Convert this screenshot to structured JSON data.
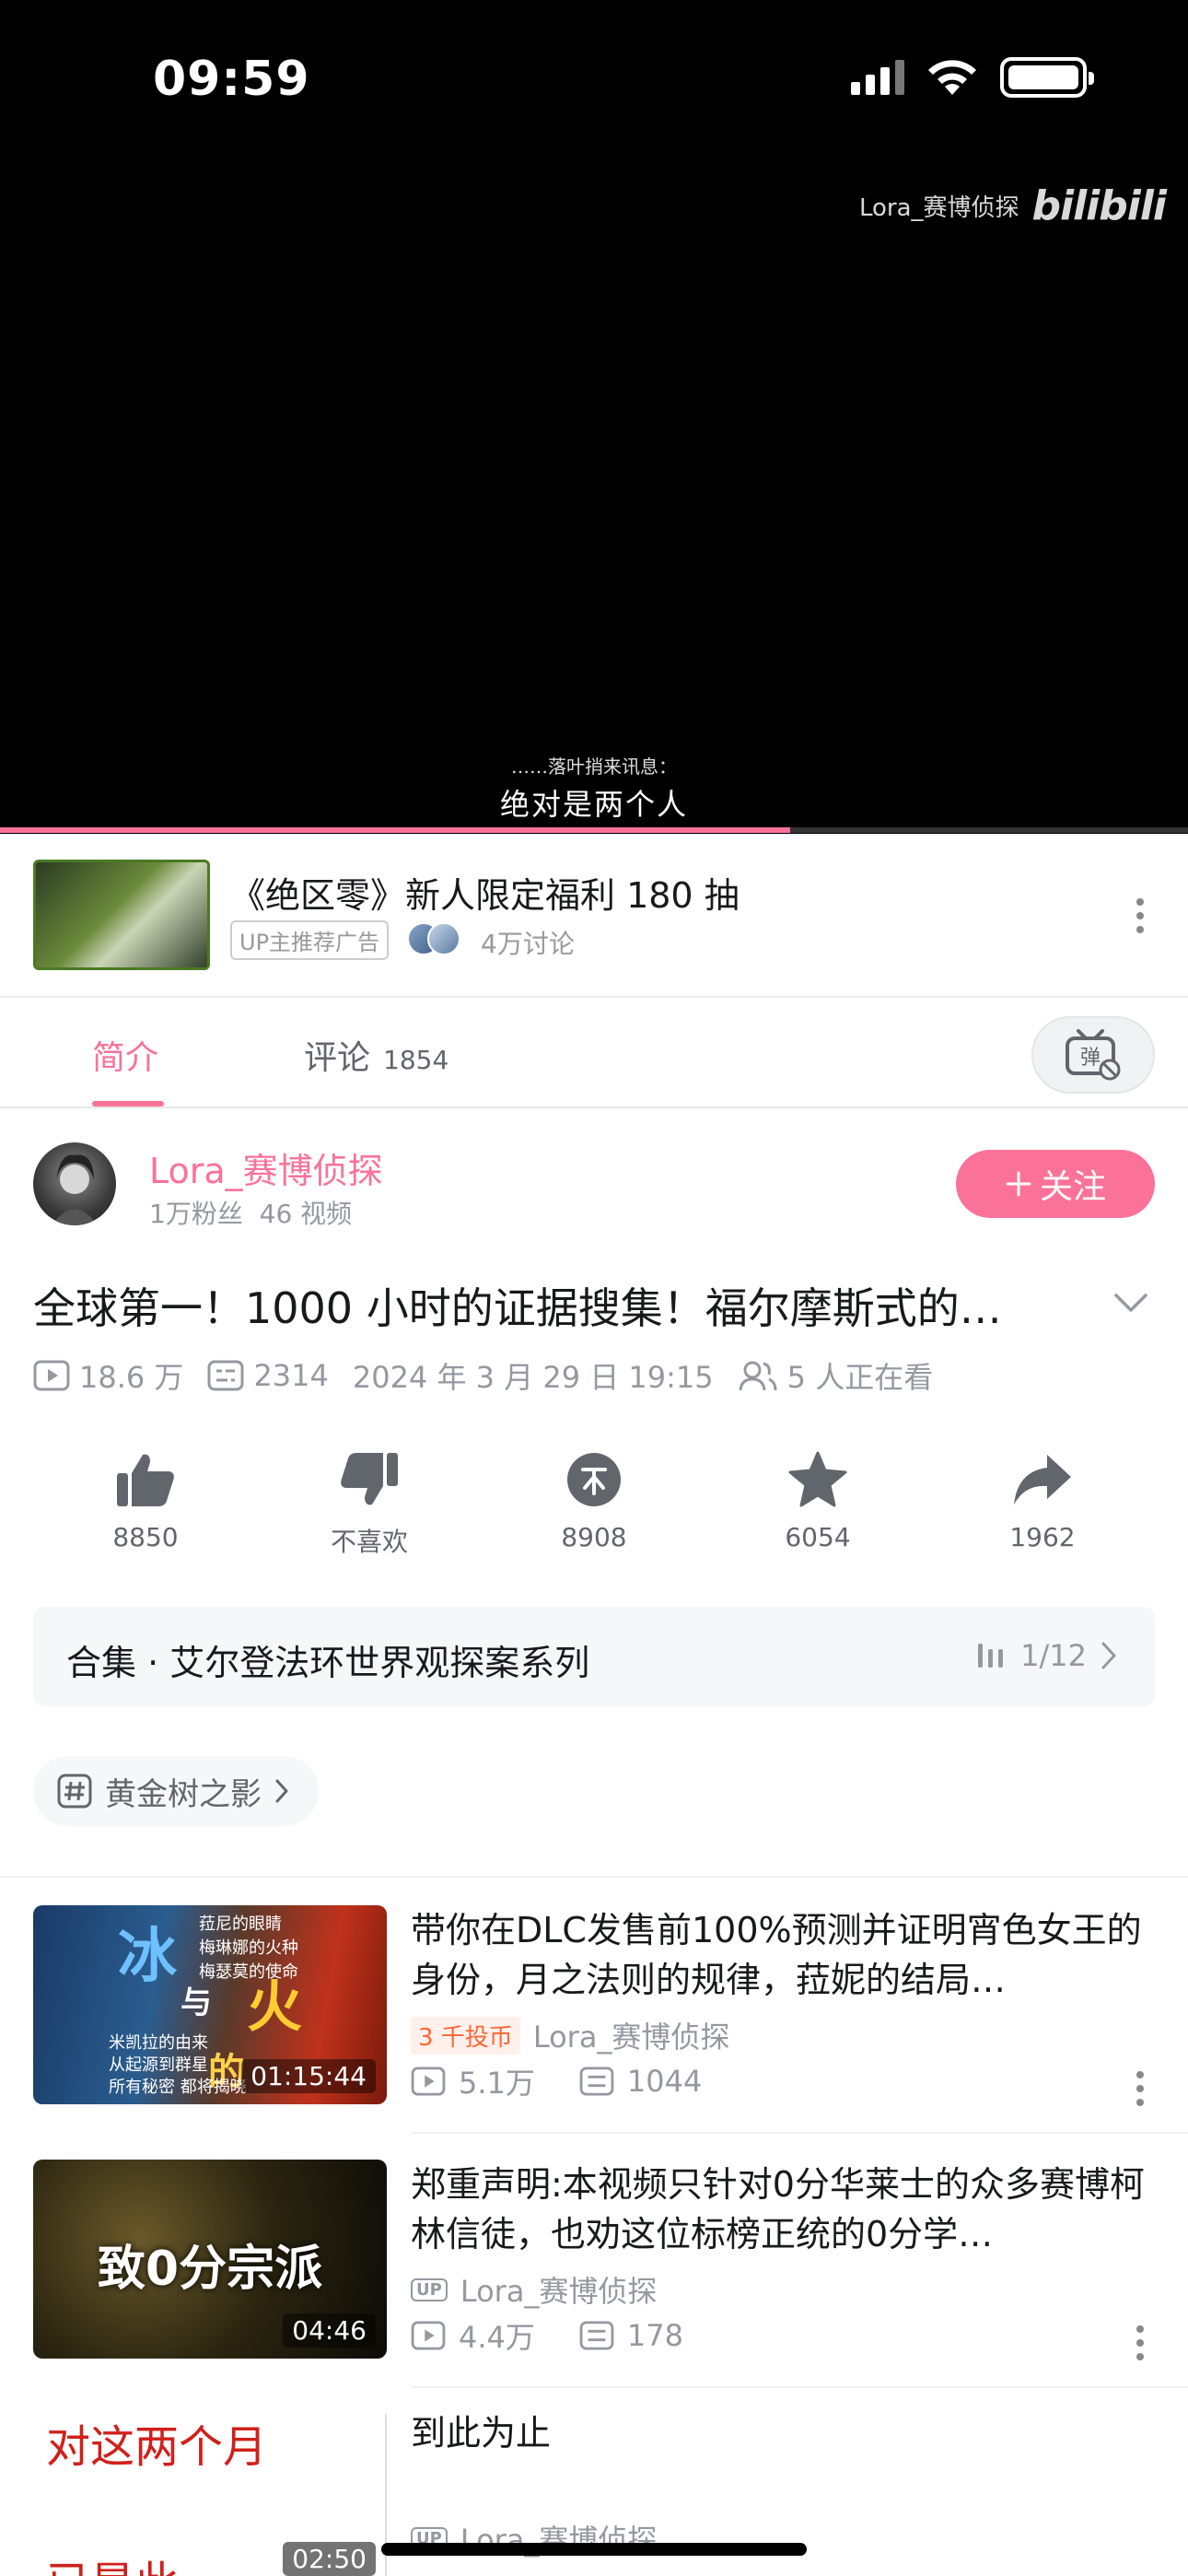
{
  "status_bar": {
    "time": "09:59"
  },
  "video": {
    "watermark_text": "Lora_赛博侦探",
    "watermark_logo": "bilibili",
    "subtitle_small": "……落叶捎来讯息：",
    "subtitle_main": "绝对是两个人",
    "progress": 0.665,
    "accent": "#fb7299"
  },
  "ad": {
    "title": "《绝区零》新人限定福利 180 抽",
    "badge": "UP主推荐广告",
    "discussion": "4万讨论"
  },
  "tabs": [
    {
      "label": "简介",
      "active": true
    },
    {
      "label": "评论",
      "count": "1854",
      "active": false
    }
  ],
  "danmaku_button": {
    "icon": "danmaku-off-icon"
  },
  "uploader": {
    "name": "Lora_赛博侦探",
    "fans": "1万粉丝",
    "videos": "46 视频",
    "follow_label": "关注"
  },
  "video_info": {
    "title": "全球第一！1000 小时的证据搜集！福尔摩斯式的…",
    "plays": "18.6 万",
    "danmaku": "2314",
    "date": "2024 年 3 月 29 日 19:15",
    "watching": "5 人正在看"
  },
  "actions": [
    {
      "icon": "thumbs-up-icon",
      "label": "8850"
    },
    {
      "icon": "thumbs-down-icon",
      "label": "不喜欢"
    },
    {
      "icon": "coin-icon",
      "label": "8908"
    },
    {
      "icon": "star-icon",
      "label": "6054"
    },
    {
      "icon": "share-icon",
      "label": "1962"
    }
  ],
  "collection": {
    "title": "合集 · 艾尔登法环世界观探案系列",
    "progress": "1/12"
  },
  "tag": {
    "label": "黄金树之影"
  },
  "related": [
    {
      "title": "带你在DLC发售前100%预测并证明宵色女王的身份，月之法则的规律，菈妮的结局…",
      "badge": "3 千投币",
      "author": "Lora_赛博侦探",
      "plays": "5.1万",
      "danmaku": "1044",
      "duration": "01:15:44",
      "thumb_lines": [
        "菈尼的眼睛",
        "梅琳娜的火种",
        "梅瑟莫的使命",
        "冰",
        "与",
        "火",
        "的",
        "米凯拉的由来",
        "从起源到群星",
        "所有秘密 都将揭晓"
      ]
    },
    {
      "title": "郑重声明:本视频只针对0分华莱士的众多赛博柯林信徒，也劝这位标榜正统的0分学…",
      "author": "Lora_赛博侦探",
      "plays": "4.4万",
      "danmaku": "178",
      "duration": "04:46",
      "thumb_lines": [
        "致0分宗派"
      ]
    },
    {
      "title": "到此为止",
      "author": "Lora_赛博侦探",
      "duration": "02:50",
      "thumb_lines": [
        "对这两个月",
        "已是此…"
      ]
    }
  ]
}
